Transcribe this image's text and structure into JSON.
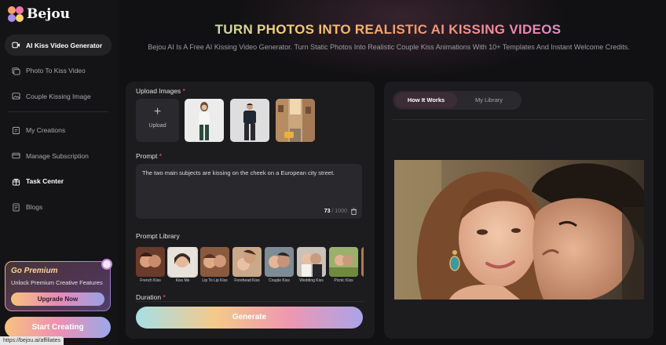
{
  "brand": {
    "name": "Bejou"
  },
  "sidebar": {
    "items": [
      {
        "label": "AI Kiss Video Generator",
        "icon": "video-sparkle-icon",
        "active": true
      },
      {
        "label": "Photo To Kiss Video",
        "icon": "photo-video-icon"
      },
      {
        "label": "Couple Kissing Image",
        "icon": "image-icon"
      },
      {
        "label": "My Creations",
        "icon": "folder-icon"
      },
      {
        "label": "Manage Subscription",
        "icon": "card-icon"
      },
      {
        "label": "Task Center",
        "icon": "gift-icon"
      },
      {
        "label": "Blogs",
        "icon": "document-icon"
      }
    ],
    "premium": {
      "title": "Go Premium",
      "subtitle": "Unlock Premium Creative Features",
      "button": "Upgrade Now"
    },
    "start_button": "Start Creating"
  },
  "header": {
    "title": "TURN PHOTOS INTO REALISTIC AI KISSING VIDEOS",
    "subtitle": "Bejou AI Is A Free AI Kissing Video Generator. Turn Static Photos Into Realistic Couple Kiss Animations With 10+ Templates And Instant Welcome Credits."
  },
  "form": {
    "upload_label": "Upload Images",
    "upload_button": "Upload",
    "prompt_label": "Prompt",
    "prompt_text": "The two main subjects are kissing on the cheek on a European city street.",
    "char_count": "73",
    "char_max": "/ 1000",
    "library_label": "Prompt Library",
    "library": [
      {
        "name": "French Kiss"
      },
      {
        "name": "Kiss Me"
      },
      {
        "name": "Lip To Lip Kiss"
      },
      {
        "name": "Forehead Kiss"
      },
      {
        "name": "Couple Kiss"
      },
      {
        "name": "Wedding Kiss"
      },
      {
        "name": "Picnic Kiss"
      }
    ],
    "duration_label": "Duration",
    "generate_button": "Generate"
  },
  "preview": {
    "tabs": [
      "How It Works",
      "My Library"
    ]
  },
  "status_url": "https://bejou.ai/affiliates",
  "colors": {
    "accent_pink": "#ee86b8",
    "accent_gold": "#f6d377",
    "required": "#ff5a76"
  }
}
